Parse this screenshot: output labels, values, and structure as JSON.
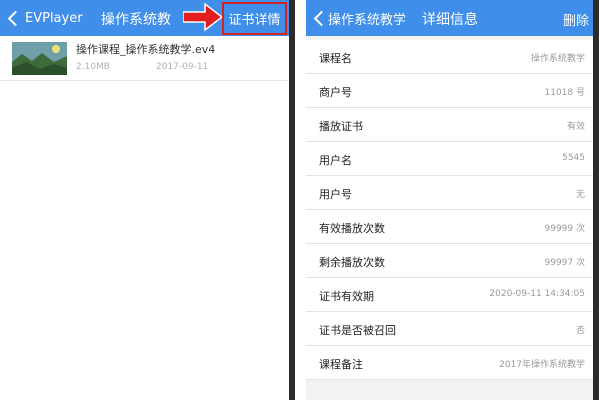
{
  "left": {
    "nav": {
      "back_label": "EVPlayer",
      "title": "操作系统教",
      "cert_button": "证书详情"
    },
    "video": {
      "name": "操作课程_操作系统教学.ev4",
      "size": "2.10MB",
      "date": "2017-09-11"
    }
  },
  "right": {
    "nav": {
      "back_label": "操作系统教学",
      "title": "详细信息",
      "delete_button": "删除"
    },
    "details": [
      {
        "label": "课程名",
        "value": "操作系统教学"
      },
      {
        "label": "商户号",
        "value": "11018 号"
      },
      {
        "label": "播放证书",
        "value": "有效"
      },
      {
        "label": "用户名",
        "value": "5545"
      },
      {
        "label": "用户号",
        "value": "无"
      },
      {
        "label": "有效播放次数",
        "value": "99999 次"
      },
      {
        "label": "剩余播放次数",
        "value": "99997 次"
      },
      {
        "label": "证书有效期",
        "value": "2020-09-11 14:34:05"
      },
      {
        "label": "证书是否被召回",
        "value": "否"
      },
      {
        "label": "课程备注",
        "value": "2017年操作系统教学"
      }
    ]
  },
  "colors": {
    "nav_blue": "#3f8fea",
    "highlight_red": "#d32222"
  },
  "icons": {
    "back": "chevron-left-icon",
    "annotation": "red-arrow-icon"
  }
}
